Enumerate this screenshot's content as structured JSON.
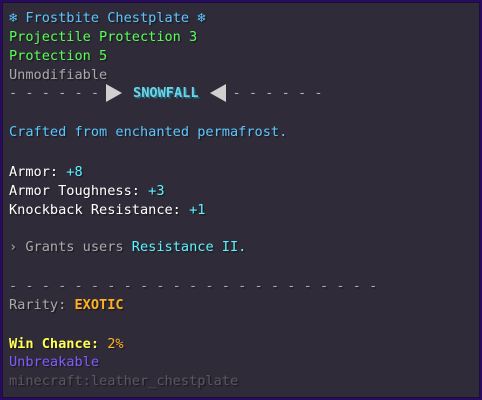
{
  "item": {
    "title_icon_left": "❄",
    "title": "Frostbite Chestplate",
    "title_icon_right": "❄",
    "enchantments": [
      "Projectile Protection 3",
      "Protection 5"
    ],
    "unmodifiable": "Unmodifiable",
    "set_separator": {
      "left_dashes": "- - - - - -",
      "label": "SNOWFALL",
      "right_dashes": "- - - - - -"
    },
    "lore": "Crafted from enchanted permafrost.",
    "stats": [
      {
        "label": "Armor:",
        "value": "+8"
      },
      {
        "label": "Armor Toughness:",
        "value": "+3"
      },
      {
        "label": "Knockback Resistance:",
        "value": "+1"
      }
    ],
    "ability": {
      "prefix": "›",
      "text": "Grants users",
      "effect": "Resistance II."
    },
    "divider": "- - - - - - - - - - - - - - - - - - - - - - -",
    "rarity_label": "Rarity:",
    "rarity_value": "EXOTIC",
    "win_chance_label": "Win Chance:",
    "win_chance_value": "2%",
    "unbreakable": "Unbreakable",
    "item_id": "minecraft:leather_chestplate"
  },
  "colors": {
    "background": "#302b38",
    "border": "#2a0a5e",
    "title": "#59c7ff",
    "enchant": "#55ff55",
    "lore": "#59c7ff",
    "stat_value": "#5af4ff",
    "rarity": "#ffb124",
    "win_chance": "#ffff55",
    "unbreakable": "#7d5cff"
  }
}
